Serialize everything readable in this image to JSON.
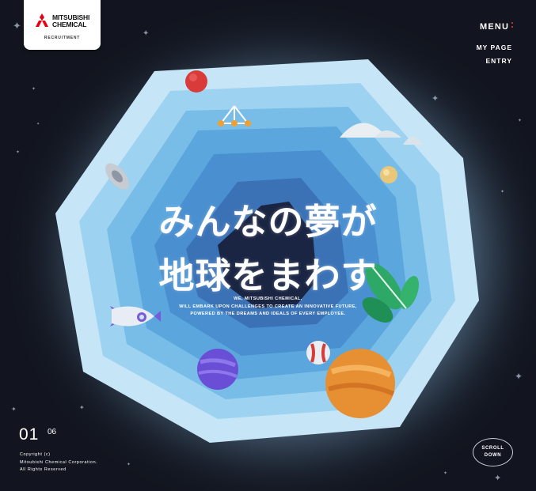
{
  "brand": {
    "name_line1": "MITSUBISHI",
    "name_line2": "CHEMICAL",
    "sub": "RECRUITMENT",
    "logo_color": "#e60012"
  },
  "nav": {
    "menu_label": "MENU",
    "links": [
      "MY PAGE",
      "ENTRY"
    ]
  },
  "hero": {
    "headline_line1": "みんなの夢が",
    "headline_line2": "地球をまわす",
    "tagline": [
      "WE, MITSUBISHI CHEMICAL,",
      "WILL EMBARK UPON CHALLENGES TO CREATE AN INNOVATIVE FUTURE,",
      "POWERED BY THE DREAMS AND IDEALS OF EVERY EMPLOYEE."
    ]
  },
  "slider": {
    "current": "01",
    "total": "06"
  },
  "footer": {
    "copyright_lines": [
      "Copyright (c)",
      "Mitsubishi Chemical Corporation.",
      "All Rights Reserved"
    ]
  },
  "scroll": {
    "line1": "SCROLL",
    "line2": "DOWN"
  },
  "illustration": {
    "icons": [
      "red-planet-icon",
      "satellite-icon",
      "cloud-icon",
      "ufo-icon",
      "moon-icon",
      "rocket-icon",
      "leaf-icon",
      "purple-planet-icon",
      "hot-air-balloon-icon",
      "orange-planet-icon"
    ],
    "colors": {
      "background": "#12151f",
      "portal_outer": "#b7dcf3",
      "portal_mid": "#7cc0e8",
      "portal_inner": "#4a8fd0",
      "portal_core": "#1a2543"
    }
  }
}
